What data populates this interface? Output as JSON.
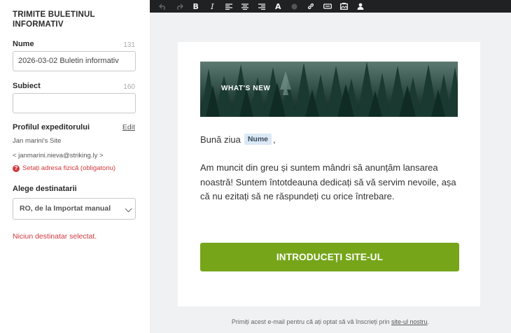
{
  "sidebar": {
    "title": "TRIMITE BULETINUL INFORMATIV",
    "name_field": {
      "label": "Nume",
      "count": "131",
      "value": "2026-03-02 Buletin informativ"
    },
    "subject_field": {
      "label": "Subiect",
      "count": "160",
      "value": ""
    },
    "sender": {
      "label": "Profilul expeditorului",
      "edit": "Edit",
      "name": "Jan marini's Site",
      "email": "< janmarini.nieva@striking.ly >",
      "warning": "Setați adresa fizică (obligatoriu)"
    },
    "recipients": {
      "label": "Alege destinatarii",
      "selected": "RO, de la Importat manual",
      "empty_message": "Niciun destinatar selectat."
    }
  },
  "toolbar": {
    "buttons": [
      "undo-icon",
      "redo-icon",
      "bold-icon",
      "italic-icon",
      "align-left-icon",
      "align-center-icon",
      "align-right-icon",
      "font-icon",
      "color-icon",
      "link-icon",
      "button-icon",
      "image-icon",
      "user-icon"
    ],
    "bold": "B",
    "italic": "I",
    "font": "A",
    "bg_color": "#1f2123"
  },
  "email": {
    "hero_text": "WHAT'S NEW",
    "greeting": "Bună ziua",
    "name_tag": "Nume",
    "greeting_suffix": ",",
    "body": "Am muncit din greu și suntem mândri să anunțăm lansarea noastră! Suntem întotdeauna dedicați să vă servim nevoile, așa că nu ezitați să ne răspundeți cu orice întrebare.",
    "cta": "INTRODUCEȚI SITE-UL",
    "cta_color": "#76a51a"
  },
  "footer": {
    "text": "Primiți acest e-mail pentru că ați optat să vă înscrieți prin",
    "link": "site-ul nostru",
    "suffix": "."
  },
  "colors": {
    "error": "#d0393e",
    "editor_bg": "#eff1f3",
    "tag_bg": "#dbe8f6"
  }
}
